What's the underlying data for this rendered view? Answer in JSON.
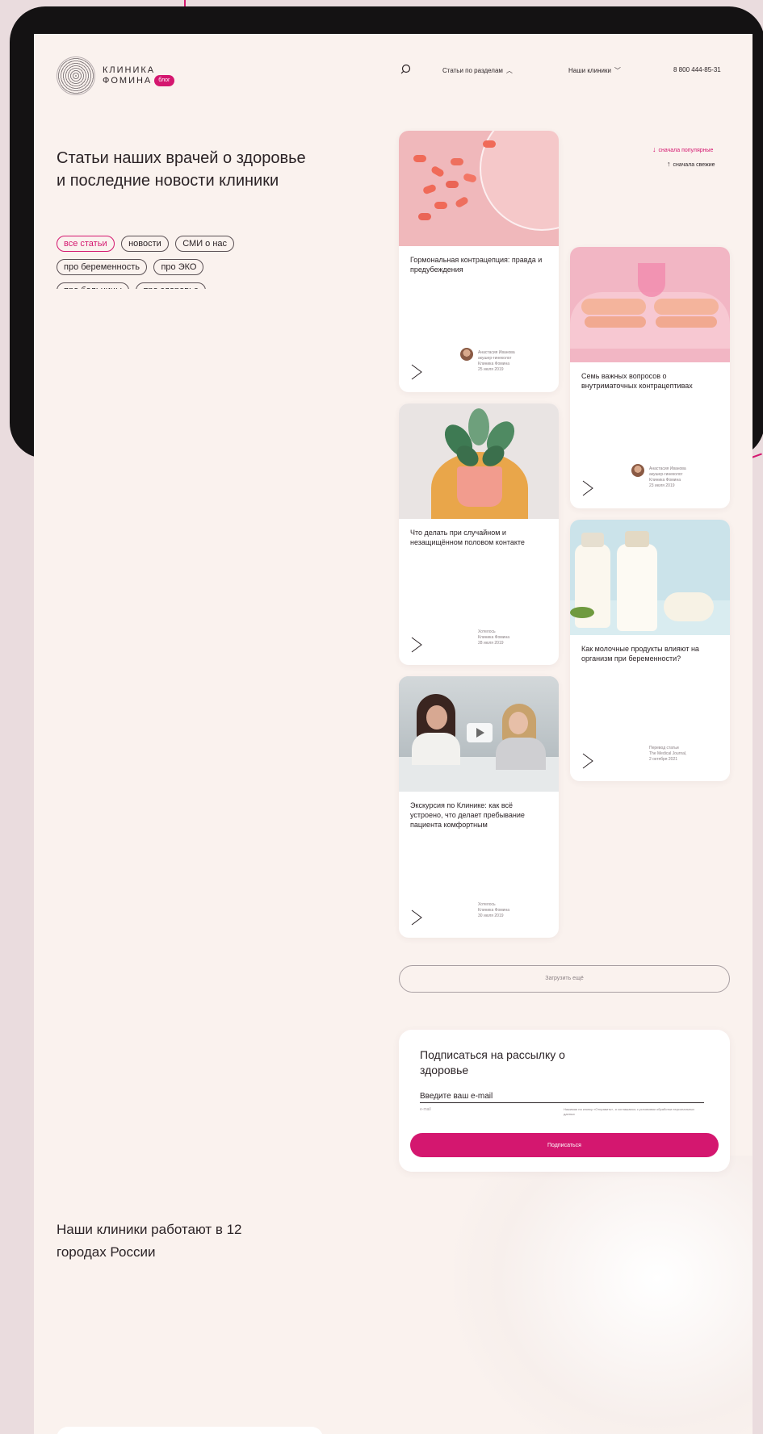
{
  "brand": {
    "name_line1": "КЛИНИКА",
    "name_line2": "ФОМИНА",
    "badge": "блог",
    "logo_icon": "dotted-circle-logo"
  },
  "nav": {
    "search_icon": "search-icon",
    "sections": "Статьи по разделам",
    "clinics": "Наши клиники",
    "phone": "8 800 444-85-31"
  },
  "intro": {
    "title": "Статьи наших врачей о здоровье и последние новости клиники"
  },
  "tags": [
    {
      "label": "все статьи",
      "active": true
    },
    {
      "label": "новости",
      "active": false
    },
    {
      "label": "СМИ о нас",
      "active": false
    },
    {
      "label": "про беременность",
      "active": false
    },
    {
      "label": "про ЭКО",
      "active": false
    },
    {
      "label": "про больницы",
      "active": false
    },
    {
      "label": "про здоровье",
      "active": false
    }
  ],
  "sort": {
    "popular": "сначала популярные",
    "fresh": "сначала свежие"
  },
  "cards": [
    {
      "title": "Гормональная контрацепция: правда и предубеждения",
      "meta1": "Анастасия Иванова",
      "meta2": "акушер-гинеколог",
      "meta3": "Клиника Фомина",
      "meta4": "25 июля 2019"
    },
    {
      "title": "Семь важных вопросов о внутриматочных контрацептивах",
      "meta1": "Анастасия Иванова",
      "meta2": "акушер-гинеколог",
      "meta3": "Клиника Фомина",
      "meta4": "23 июля 2019"
    },
    {
      "title": "Что делать при случайном и незащищённом половом контакте",
      "meta1": "Хотелось",
      "meta2": "Клиника Фомина",
      "meta3": "28 июля 2019"
    },
    {
      "title": "Как молочные продукты влияют на организм при беременности?",
      "meta1": "Перевод статьи",
      "meta2": "The Medical Journal,",
      "meta3": "2 октября 2021"
    },
    {
      "title": "Экскурсия по Клинике: как всё устроено, что делает пребывание пациента комфортным",
      "meta1": "Хотелось",
      "meta2": "Клиника Фомина",
      "meta3": "30 июля 2019"
    }
  ],
  "load_more": "Загрузить ещё",
  "subscribe": {
    "title": "Подписаться на рассылку о здоровье",
    "placeholder": "Введите ваш e-mail",
    "hint": "e-mail",
    "consent": "Нажимая на кнопку «Отправить», я соглашаюсь с условиями обработки персональных данных",
    "button": "Подписаться"
  },
  "cities": {
    "title": "Наши клиники работают в 12 городах России"
  },
  "colors": {
    "accent": "#d4176f",
    "page_bg": "#faf2ee",
    "backdrop": "#eadcde"
  }
}
